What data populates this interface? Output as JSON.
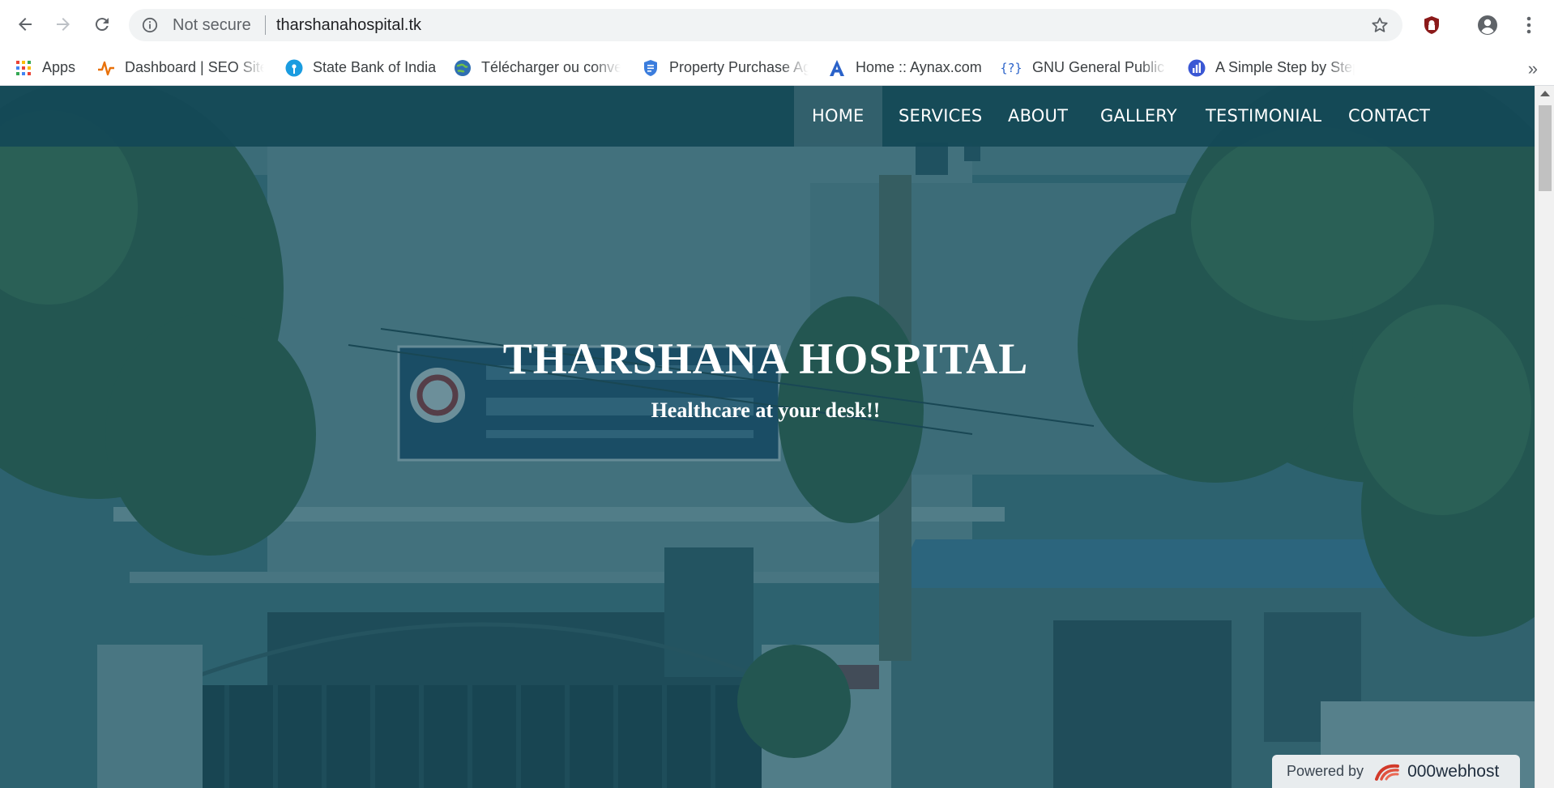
{
  "browser": {
    "security_label": "Not secure",
    "url": "tharshanahospital.tk"
  },
  "bookmarks": [
    {
      "label": "Apps",
      "icon": "apps-grid-icon"
    },
    {
      "label": "Dashboard | SEO Site",
      "icon": "pulse-icon"
    },
    {
      "label": "State Bank of India",
      "icon": "sbi-icon"
    },
    {
      "label": "Télécharger ou conve",
      "icon": "globe-icon"
    },
    {
      "label": "Property Purchase Ag",
      "icon": "shield-doc-icon"
    },
    {
      "label": "Home :: Aynax.com",
      "icon": "letter-a-icon"
    },
    {
      "label": "GNU General Public L",
      "icon": "braces-icon"
    },
    {
      "label": "A Simple Step by Step",
      "icon": "bar-chart-icon"
    }
  ],
  "site": {
    "nav": [
      "HOME",
      "SERVICES",
      "ABOUT",
      "GALLERY",
      "TESTIMONIAL",
      "CONTACT"
    ],
    "hero_title": "THARSHANA HOSPITAL",
    "hero_subtitle": "Healthcare at your desk!!",
    "powered_label": "Powered by",
    "powered_brand": "000webhost"
  },
  "colors": {
    "nav_bg": "#134856",
    "hero_overlay": "#144e60",
    "text": "#ffffff"
  }
}
